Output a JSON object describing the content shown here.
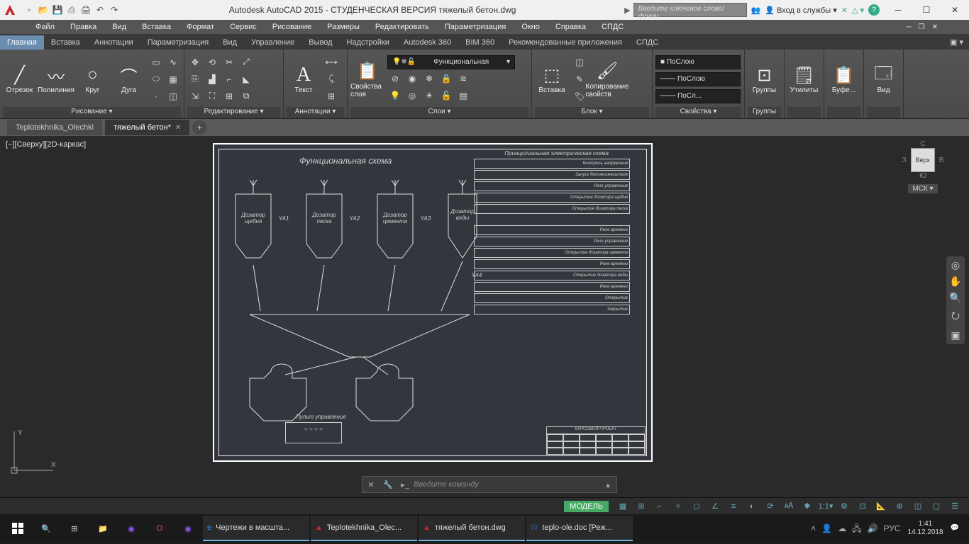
{
  "titlebar": {
    "app_title": "Autodesk AutoCAD 2015 - СТУДЕНЧЕСКАЯ ВЕРСИЯ   тяжелый бетон.dwg",
    "search_placeholder": "Введите ключевое слово/фразу",
    "signin": "Вход в службы",
    "help_icon": "?"
  },
  "menubar": {
    "items": [
      "Файл",
      "Правка",
      "Вид",
      "Вставка",
      "Формат",
      "Сервис",
      "Рисование",
      "Размеры",
      "Редактировать",
      "Параметризация",
      "Окно",
      "Справка",
      "СПДС"
    ]
  },
  "ribbontabs": {
    "items": [
      "Главная",
      "Вставка",
      "Аннотации",
      "Параметризация",
      "Вид",
      "Управление",
      "Вывод",
      "Надстройки",
      "Autodesk 360",
      "BIM 360",
      "Рекомендованные приложения",
      "СПДС"
    ],
    "active": 0
  },
  "ribbon": {
    "panels": {
      "draw": {
        "label": "Рисование ▾",
        "tools": [
          "Отрезок",
          "Полилиния",
          "Круг",
          "Дуга"
        ]
      },
      "modify": {
        "label": "Редактирование ▾"
      },
      "annot": {
        "label": "Аннотации ▾",
        "text": "Текст"
      },
      "layers": {
        "label": "Слои ▾",
        "layerprops": "Свойства слоя",
        "current": "Функциональная"
      },
      "block": {
        "label": "Блок ▾",
        "insert": "Вставка",
        "copy": "Копирование свойств"
      },
      "props": {
        "label": "Свойства ▾",
        "bycolor": "■ ПоСлою",
        "byline": "─── ПоСлою",
        "byweight": "─── ПоСл..."
      },
      "groups": {
        "label": "Группы",
        "title": "Группы"
      },
      "utils": {
        "label": " ",
        "title": "Утилиты"
      },
      "clip": {
        "label": " ",
        "title": "Буфе..."
      },
      "view": {
        "label": " ",
        "title": "Вид"
      }
    }
  },
  "doctabs": {
    "tabs": [
      {
        "name": "Teplotekhnika_Olechki",
        "active": false
      },
      {
        "name": "тяжелый бетон*",
        "active": true
      }
    ]
  },
  "canvas": {
    "viewlabel": "[−][Сверху][2D-каркас]",
    "drawing_title": "Функциональная схема",
    "el_title": "Принципиальная электрическая схема",
    "hoppers": [
      {
        "label": "Дозатор щебня",
        "v": "YA1"
      },
      {
        "label": "Дозатор песка",
        "v": "YA2"
      },
      {
        "label": "Дозатор цемента",
        "v": "YA3"
      },
      {
        "label": "Дозатор воды",
        "v": "YA4"
      }
    ],
    "el_rows": [
      "Контроль напряжения",
      "Запуск бетоносмесителя",
      "Реле управления",
      "Открытие дозатора щебня",
      "Открытие дозатора песка",
      "Реле времени",
      "Реле управления",
      "Открытие дозатора цемента",
      "Реле времени",
      "Открытие дозатора воды",
      "Реле времени",
      "Открытие",
      "Закрытие"
    ],
    "titleblock": "КУРСОВОЙ ПРОЕКТ",
    "pult": "Пульт управления",
    "viewcube": {
      "n": "С",
      "s": "Ю",
      "e": "В",
      "w": "З",
      "top": "Верх",
      "msk": "МСК ▾"
    }
  },
  "cmdline": {
    "placeholder": "Введите команду"
  },
  "statusbar": {
    "model": "МОДЕЛЬ",
    "scale": "1:1"
  },
  "taskbar": {
    "apps": [
      {
        "label": "Чертежи в масшта..."
      },
      {
        "label": "Teplotekhnika_Olec..."
      },
      {
        "label": "тяжелый бетон.dwg"
      },
      {
        "label": "teplo-ole.doc [Реж..."
      }
    ],
    "lang": "РУС",
    "time": "1:41",
    "date": "14.12.2018"
  }
}
